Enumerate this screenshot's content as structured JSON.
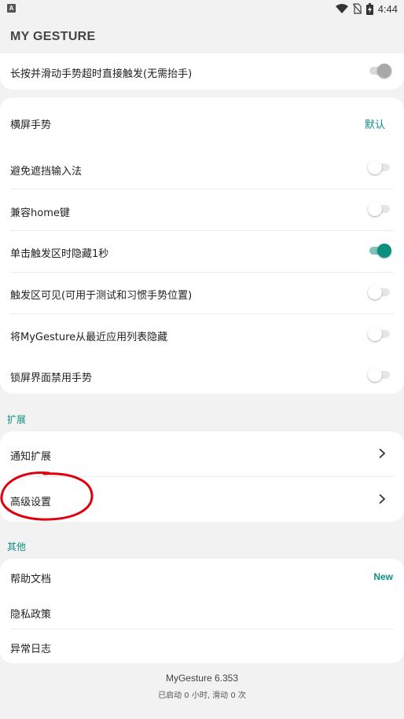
{
  "status_bar": {
    "time": "4:44",
    "left_icon": "notification-a-icon",
    "icons": [
      "wifi-icon",
      "no-sim-icon",
      "battery-icon"
    ]
  },
  "app": {
    "title": "MY GESTURE"
  },
  "top_card": {
    "label": "长按并滑动手势超时直接触发(无需抬手)",
    "toggle_state": "disabled-on"
  },
  "settings": {
    "landscape": {
      "label": "横屏手势",
      "value": "默认"
    },
    "items": [
      {
        "label": "避免遮挡输入法",
        "on": false
      },
      {
        "label": "兼容home键",
        "on": false
      },
      {
        "label": "单击触发区时隐藏1秒",
        "on": true
      },
      {
        "label": "触发区可见(可用于测试和习惯手势位置)",
        "on": false
      },
      {
        "label": "将MyGesture从最近应用列表隐藏",
        "on": false
      },
      {
        "label": "锁屏界面禁用手势",
        "on": false
      }
    ]
  },
  "extensions": {
    "header": "扩展",
    "items": [
      {
        "label": "通知扩展"
      },
      {
        "label": "高级设置"
      }
    ]
  },
  "other": {
    "header": "其他",
    "help": {
      "label": "帮助文档",
      "badge": "New"
    },
    "privacy": {
      "label": "隐私政策"
    },
    "errors": {
      "label": "异常日志"
    }
  },
  "footer": {
    "version": "MyGesture 6.353",
    "stats": "已启动 0 小时, 滑动 0 次"
  },
  "colors": {
    "accent": "#0d8f80",
    "background": "#f2f2f2",
    "card": "#ffffff",
    "annotation": "#e0000d"
  }
}
